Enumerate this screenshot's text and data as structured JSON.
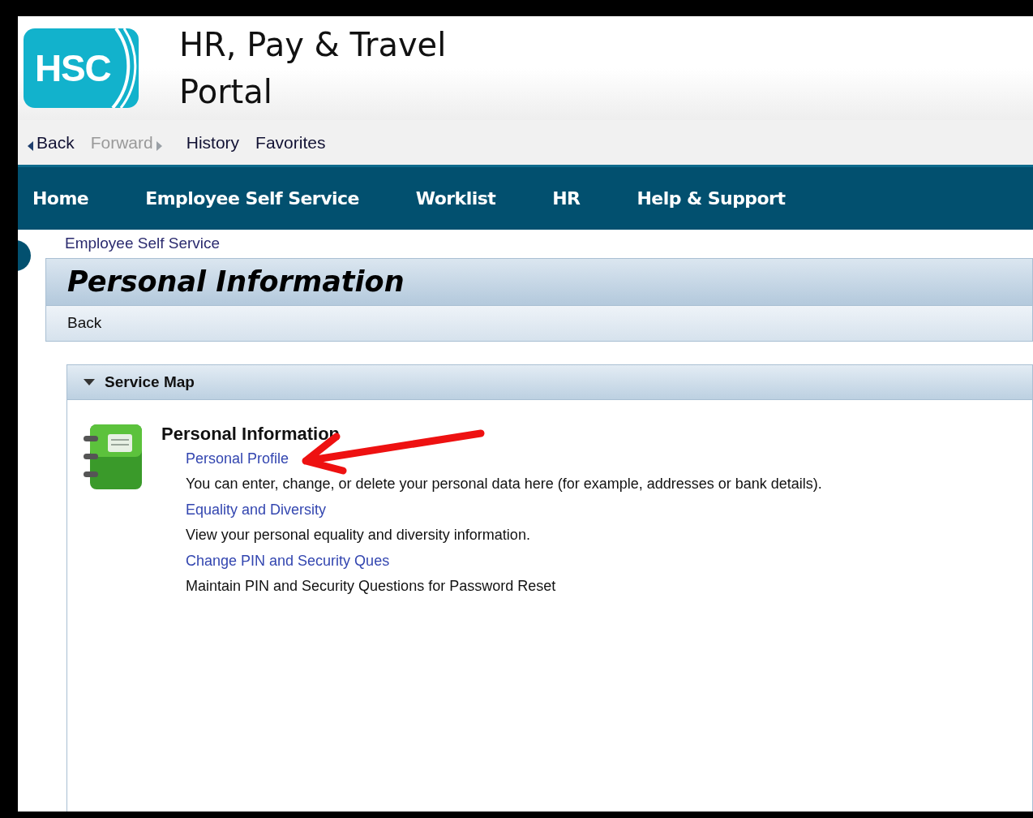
{
  "logo": {
    "text": "HSC"
  },
  "header": {
    "title_lines": [
      "HR, Pay & Travel",
      "Portal"
    ]
  },
  "history_nav": [
    {
      "label": "Back",
      "kind": "back",
      "disabled": false
    },
    {
      "label": "Forward",
      "kind": "forward",
      "disabled": true
    },
    {
      "label": "History",
      "kind": "plain",
      "disabled": false
    },
    {
      "label": "Favorites",
      "kind": "plain",
      "disabled": false
    }
  ],
  "top_nav": [
    "Home",
    "Employee Self Service",
    "Worklist",
    "HR",
    "Help & Support"
  ],
  "breadcrumb": "Employee Self Service",
  "page": {
    "title": "Personal Information",
    "toolbar": [
      "Back"
    ]
  },
  "service_map": {
    "title": "Service Map",
    "expanded": true,
    "group_title": "Personal Information",
    "items": [
      {
        "link": "Personal Profile",
        "description": "You can enter, change, or delete your personal data here (for example, addresses or bank details)."
      },
      {
        "link": "Equality and Diversity",
        "description": "View your personal equality and diversity information."
      },
      {
        "link": "Change PIN and Security Ques",
        "description": "Maintain PIN and Security Questions for Password Reset"
      }
    ]
  }
}
